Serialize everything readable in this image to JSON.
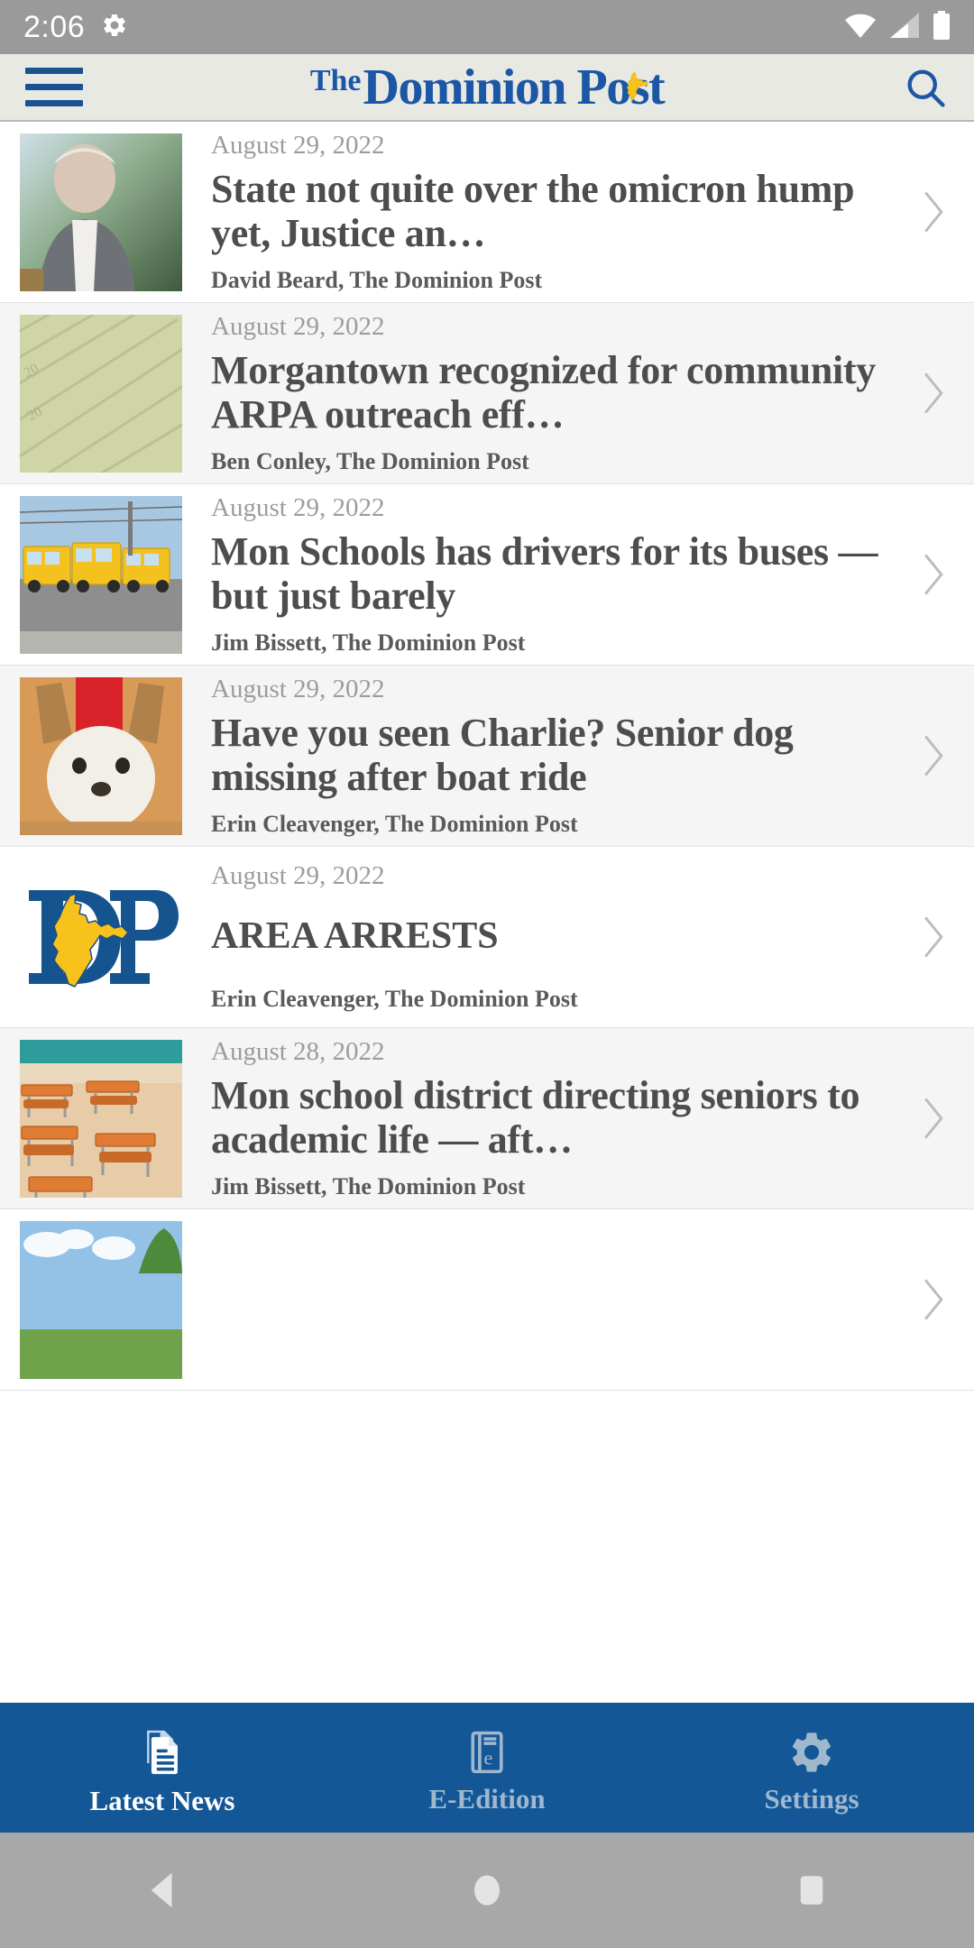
{
  "status_bar": {
    "time": "2:06",
    "icons": [
      "gear-icon",
      "wifi-icon",
      "cell-signal-icon",
      "battery-icon"
    ],
    "background": "#9a9a9a"
  },
  "header": {
    "menu_icon": "hamburger-menu-icon",
    "masthead_the": "The",
    "masthead_name": "Dominion P",
    "masthead_tail": "ost",
    "masthead_full": "The Dominion Post",
    "search_icon": "search-icon",
    "background": "#e9e9e3",
    "brand_blue": "#1c57a5",
    "brand_gold": "#f6c21b"
  },
  "list": {
    "articles": [
      {
        "date": "August 29, 2022",
        "title": "State not quite over the omicron hump yet, Justice an…",
        "byline": "David Beard, The Dominion Post",
        "thumb": "photo-governor-speaking",
        "chevron": "chevron-right-icon"
      },
      {
        "date": "August 29, 2022",
        "title": "Morgantown recognized for community ARPA outreach eff…",
        "byline": "Ben Conley, The Dominion Post",
        "thumb": "photo-dollar-bills",
        "chevron": "chevron-right-icon"
      },
      {
        "date": "August 29, 2022",
        "title": "Mon Schools has drivers for its buses — but just barely",
        "byline": "Jim Bissett, The Dominion Post",
        "thumb": "photo-school-buses",
        "chevron": "chevron-right-icon"
      },
      {
        "date": "August 29, 2022",
        "title": "Have you seen Charlie? Senior dog missing after boat ride",
        "byline": "Erin Cleavenger, The Dominion Post",
        "thumb": "photo-small-dog",
        "chevron": "chevron-right-icon"
      },
      {
        "date": "August 29, 2022",
        "title": "AREA ARRESTS",
        "byline": "Erin Cleavenger, The Dominion Post",
        "thumb": "dp-logo-icon",
        "chevron": "chevron-right-icon"
      },
      {
        "date": "August 28, 2022",
        "title": "Mon school district directing seniors to academic life — aft…",
        "byline": "Jim Bissett, The Dominion Post",
        "thumb": "photo-empty-classroom",
        "chevron": "chevron-right-icon"
      },
      {
        "date": "",
        "title": "",
        "byline": "",
        "thumb": "photo-sky-trees",
        "chevron": "chevron-right-icon"
      }
    ]
  },
  "bottom_nav": {
    "background": "#135796",
    "items": [
      {
        "label": "Latest News",
        "icon": "document-pages-icon",
        "active": true
      },
      {
        "label": "E-Edition",
        "icon": "e-book-icon",
        "active": false
      },
      {
        "label": "Settings",
        "icon": "gear-icon",
        "active": false
      }
    ]
  },
  "android_nav": {
    "background": "#a8a8a8",
    "buttons": [
      {
        "name": "back-button",
        "icon": "triangle-back-icon"
      },
      {
        "name": "home-button",
        "icon": "circle-home-icon"
      },
      {
        "name": "recents-button",
        "icon": "square-recents-icon"
      }
    ]
  }
}
